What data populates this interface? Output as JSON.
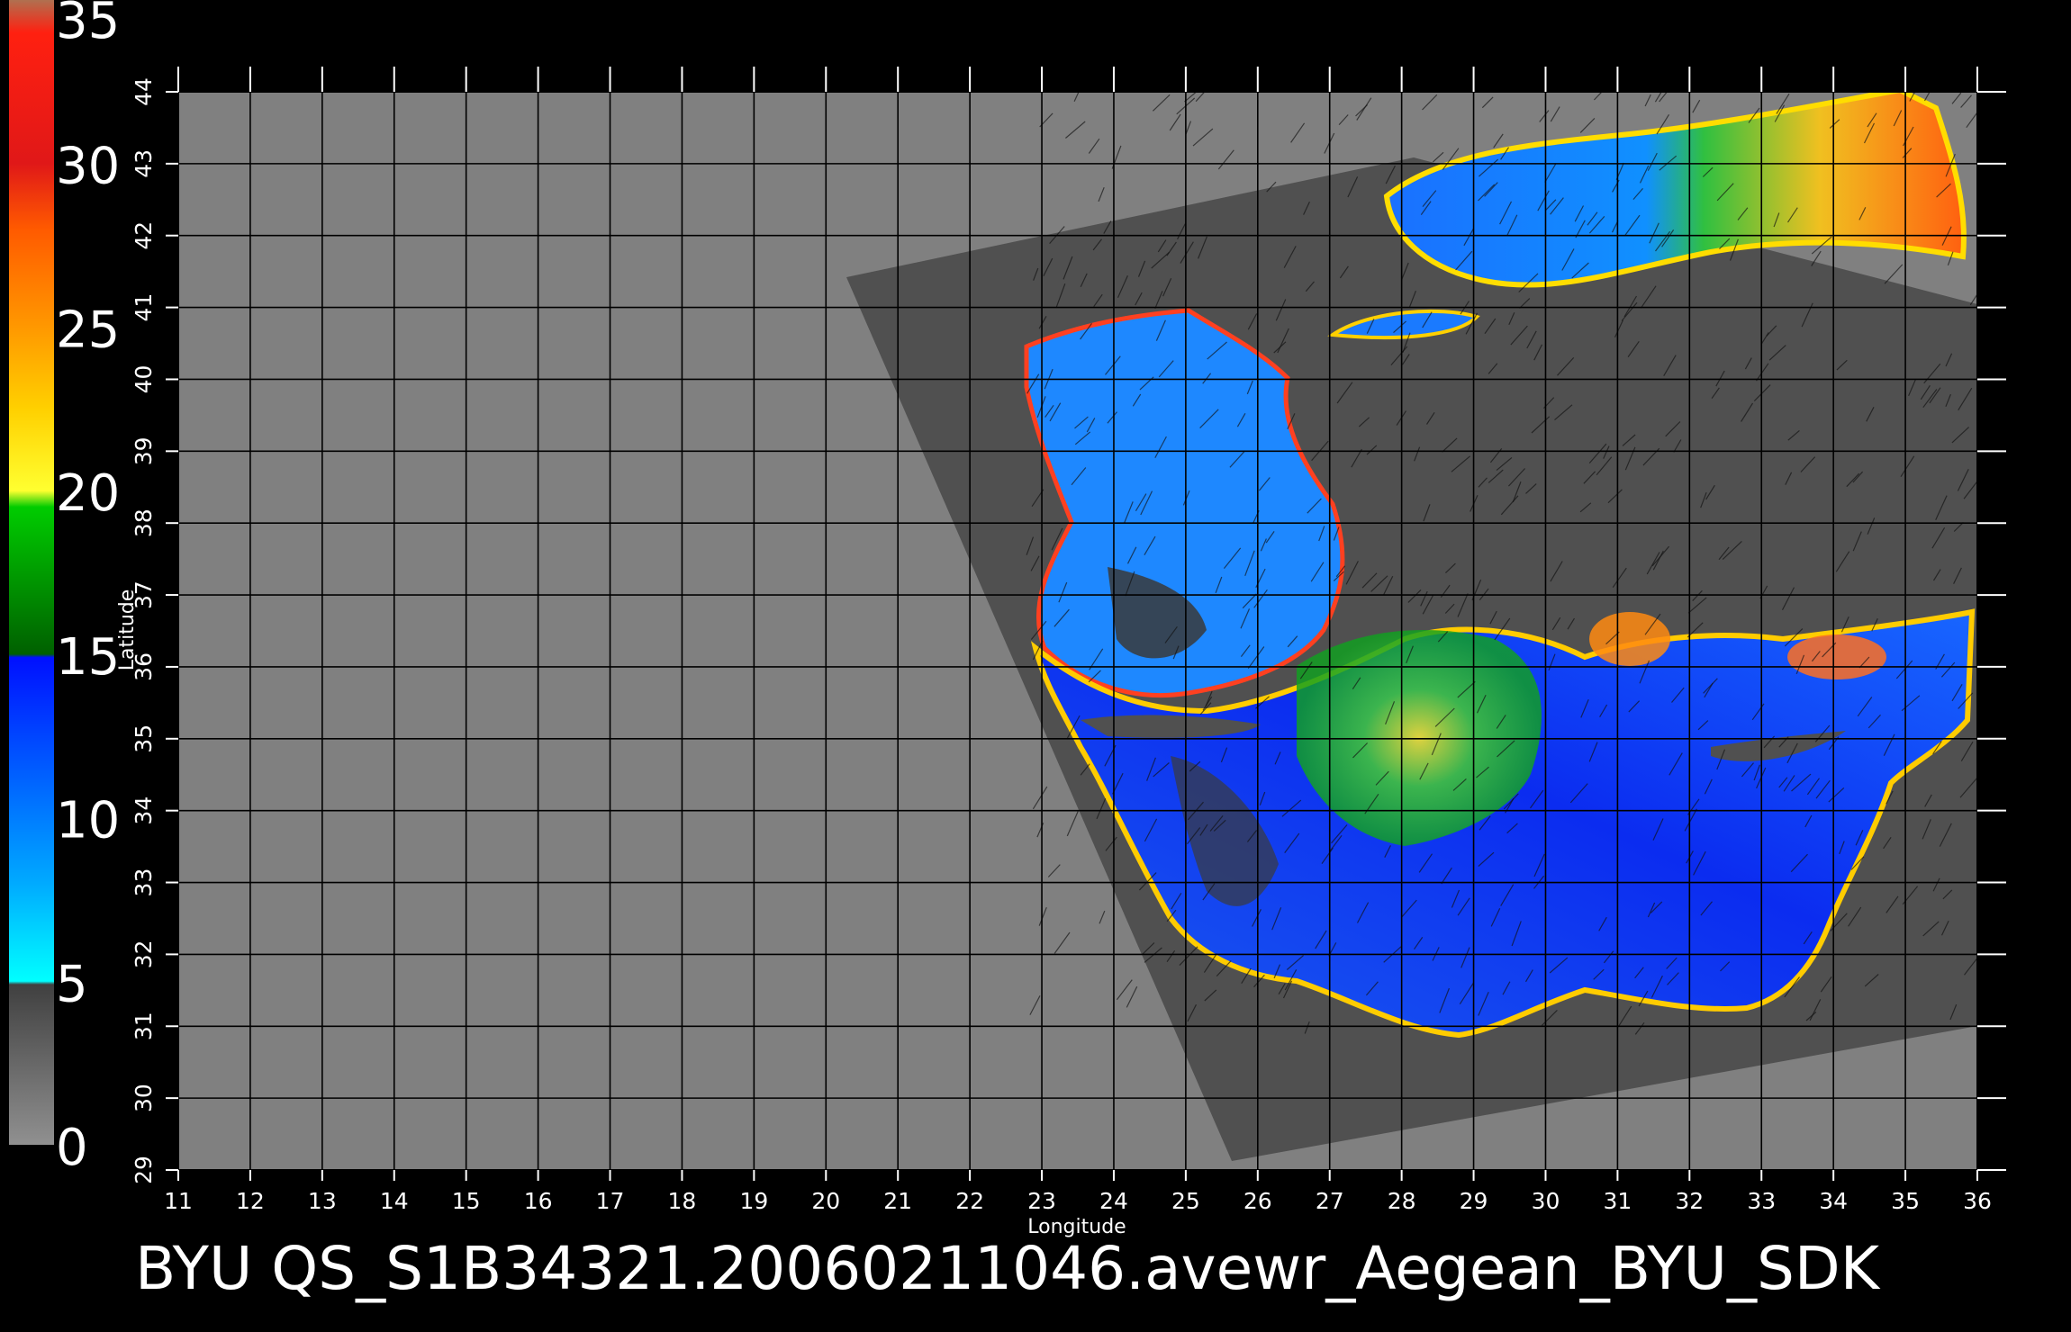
{
  "colorbar": {
    "min": 0,
    "max": 35,
    "tick_labels": [
      "35",
      "30",
      "25",
      "20",
      "15",
      "10",
      "5",
      "0"
    ],
    "tick_values": [
      35,
      30,
      25,
      20,
      15,
      10,
      5,
      0
    ],
    "stops": [
      {
        "value": 35,
        "color": "#b07050"
      },
      {
        "value": 34,
        "color": "#ff2010"
      },
      {
        "value": 30,
        "color": "#e01818"
      },
      {
        "value": 28,
        "color": "#ff5a00"
      },
      {
        "value": 25,
        "color": "#ff9800"
      },
      {
        "value": 22.5,
        "color": "#ffd000"
      },
      {
        "value": 20,
        "color": "#ffff30"
      },
      {
        "value": 19.5,
        "color": "#00cc00"
      },
      {
        "value": 15,
        "color": "#006000"
      },
      {
        "value": 14.9,
        "color": "#0010ff"
      },
      {
        "value": 12,
        "color": "#0050ff"
      },
      {
        "value": 8,
        "color": "#00aaff"
      },
      {
        "value": 5,
        "color": "#00ffff"
      },
      {
        "value": 4.9,
        "color": "#404040"
      },
      {
        "value": 0,
        "color": "#909090"
      }
    ]
  },
  "map": {
    "longitude_ticks": [
      "11",
      "12",
      "13",
      "14",
      "15",
      "16",
      "17",
      "18",
      "19",
      "20",
      "21",
      "22",
      "23",
      "24",
      "25",
      "26",
      "27",
      "28",
      "29",
      "30",
      "31",
      "32",
      "33",
      "34",
      "35",
      "36"
    ],
    "latitude_ticks": [
      "29",
      "30",
      "31",
      "32",
      "33",
      "34",
      "35",
      "36",
      "37",
      "38",
      "39",
      "40",
      "41",
      "42",
      "43",
      "44"
    ],
    "lon_range": [
      11,
      36
    ],
    "lat_range": [
      29,
      44
    ],
    "xlabel": "Longitude",
    "ylabel": "Latitude",
    "colors": {
      "background": "#000000",
      "no_data": "#808080",
      "swath": "#505050",
      "grid": "#000000",
      "axis": "#ffffff"
    }
  },
  "footer": {
    "caption": "BYU QS_S1B34321.20060211046.avewr_Aegean_BYU_SDK"
  }
}
